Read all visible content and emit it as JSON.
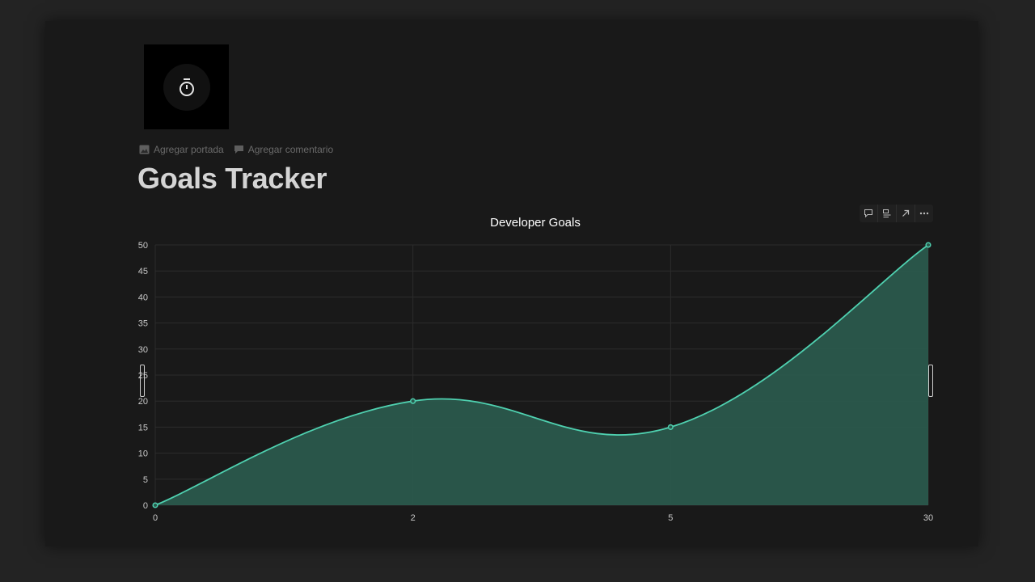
{
  "page": {
    "icon": "stopwatch-icon",
    "title": "Goals Tracker",
    "actions": {
      "add_cover": "Agregar portada",
      "add_comment": "Agregar comentario"
    }
  },
  "toolbar": {
    "icons": [
      "comment-icon",
      "caption-icon",
      "open-arrow-icon",
      "more-icon"
    ]
  },
  "colors": {
    "background": "#191919",
    "line": "#4fd1b0",
    "fill": "#2a5a4d",
    "title": "#d4d4d4"
  },
  "chart_data": {
    "type": "area",
    "title": "Developer Goals",
    "categories": [
      "0",
      "2",
      "5",
      "30"
    ],
    "values": [
      0,
      20,
      15,
      50
    ],
    "ylim": [
      0,
      50
    ],
    "yticks": [
      0,
      5,
      10,
      15,
      20,
      25,
      30,
      35,
      40,
      45,
      50
    ],
    "grid": true,
    "smooth": true
  }
}
